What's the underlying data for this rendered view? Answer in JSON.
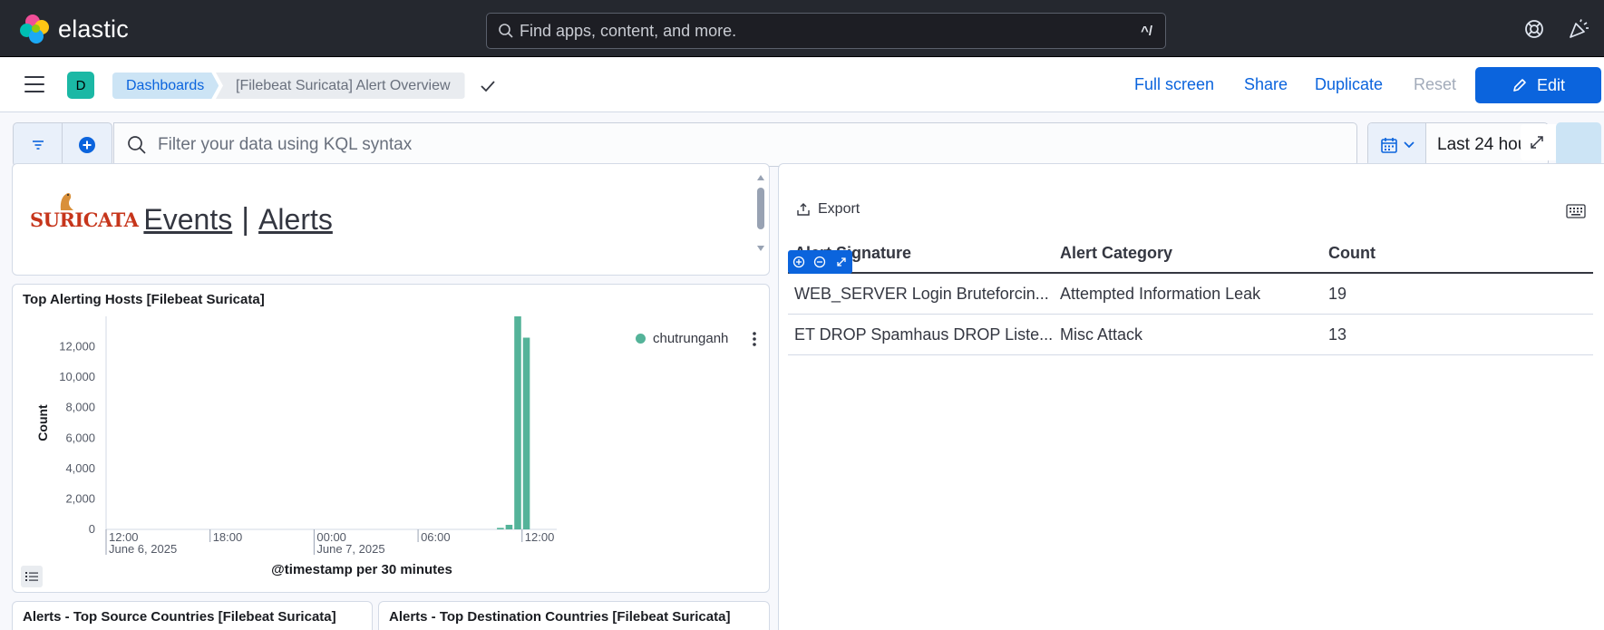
{
  "header": {
    "brand": "elastic",
    "search_placeholder": "Find apps, content, and more.",
    "search_shortcut": "^/"
  },
  "nav": {
    "space_initial": "D",
    "breadcrumbs": [
      "Dashboards",
      "[Filebeat Suricata] Alert Overview"
    ],
    "links": {
      "full_screen": "Full screen",
      "share": "Share",
      "duplicate": "Duplicate",
      "reset": "Reset",
      "edit": "Edit"
    }
  },
  "query": {
    "placeholder": "Filter your data using KQL syntax",
    "time_range": "Last 24 hou"
  },
  "markdown_panel": {
    "logo_text": "SURICATA",
    "link_events": "Events",
    "separator": "|",
    "link_alerts": "Alerts"
  },
  "hosts_panel": {
    "title": "Top Alerting Hosts [Filebeat Suricata]",
    "legend": "chutrunganh"
  },
  "chart_data": {
    "type": "bar",
    "title": "Top Alerting Hosts [Filebeat Suricata]",
    "xlabel": "@timestamp per 30 minutes",
    "ylabel": "Count",
    "ylim": [
      0,
      14000
    ],
    "yticks": [
      "0",
      "2,000",
      "4,000",
      "6,000",
      "8,000",
      "10,000",
      "12,000"
    ],
    "xticks": [
      {
        "label": "12:00",
        "sub": "June 6, 2025"
      },
      {
        "label": "18:00",
        "sub": ""
      },
      {
        "label": "00:00",
        "sub": "June 7, 2025"
      },
      {
        "label": "06:00",
        "sub": ""
      },
      {
        "label": "12:00",
        "sub": ""
      }
    ],
    "series": [
      {
        "name": "chutrunganh",
        "color": "#54b399",
        "x": [
          "2025-06-07T10:30",
          "2025-06-07T11:00",
          "2025-06-07T11:30",
          "2025-06-07T12:00"
        ],
        "values": [
          100,
          300,
          14000,
          12600
        ]
      }
    ],
    "legend_position": "top-right",
    "grid": false
  },
  "alerts_table": {
    "export_label": "Export",
    "columns": [
      "Alert Signature",
      "Alert Category",
      "Count"
    ],
    "rows": [
      {
        "signature": "WEB_SERVER Login Bruteforcin...",
        "category": "Attempted Information Leak",
        "count": "19"
      },
      {
        "signature": "ET DROP Spamhaus DROP Liste...",
        "category": "Misc Attack",
        "count": "13"
      }
    ]
  },
  "bottom_panels": {
    "source_title": "Alerts - Top Source Countries [Filebeat Suricata]",
    "destination_title": "Alerts - Top Destination Countries [Filebeat Suricata]"
  }
}
